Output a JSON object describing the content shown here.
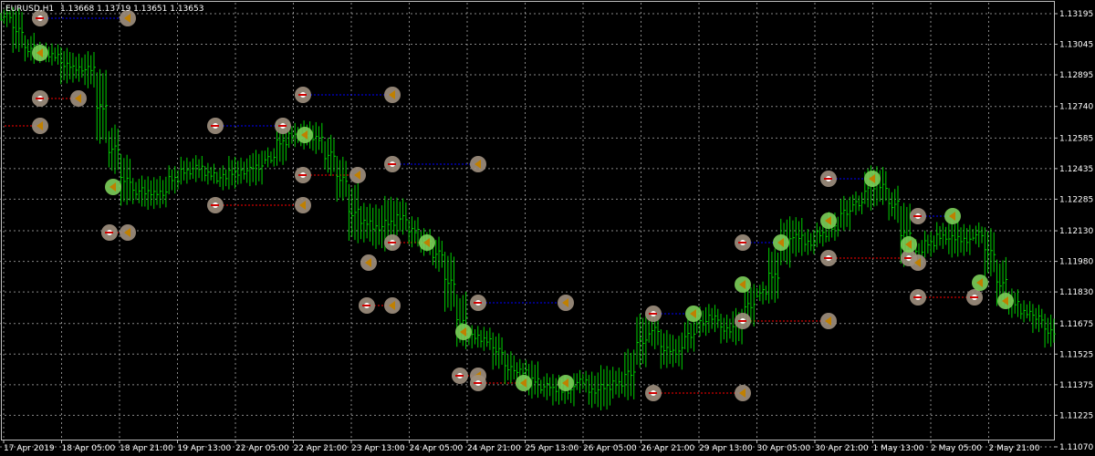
{
  "window": {
    "symbol_label": "EURUSD,H1",
    "ohlc_label": "1.13668 1.13719 1.13651 1.13653"
  },
  "colors": {
    "background": "#000000",
    "grid": "#c0c0c0",
    "bull_bar": "#00d000",
    "bear_bar": "#00d000",
    "buy_line": "#0000ff",
    "sell_line": "#ff0000",
    "marker_ring": "#a09080",
    "marker_green": "#7ccf5a",
    "marker_arrow": "#c08000",
    "axis_text": "#ffffff"
  },
  "chart_data": {
    "type": "line",
    "title": "EURUSD,H1 1.13668 1.13719 1.13651 1.13653",
    "xlabel": "",
    "ylabel": "",
    "ylim": [
      1.1107,
      1.13195
    ],
    "y_ticks": [
      "1.13195",
      "1.13045",
      "1.12895",
      "1.12740",
      "1.12585",
      "1.12435",
      "1.12285",
      "1.12130",
      "1.11980",
      "1.11830",
      "1.11675",
      "1.11525",
      "1.11375",
      "1.11225",
      "1.11070"
    ],
    "x_ticks": [
      "17 Apr 2019",
      "18 Apr 05:00",
      "18 Apr 21:00",
      "19 Apr 13:00",
      "22 Apr 05:00",
      "22 Apr 21:00",
      "23 Apr 13:00",
      "24 Apr 05:00",
      "24 Apr 21:00",
      "25 Apr 13:00",
      "26 Apr 05:00",
      "26 Apr 21:00",
      "29 Apr 13:00",
      "30 Apr 05:00",
      "30 Apr 21:00",
      "1 May 13:00",
      "2 May 05:00",
      "2 May 21:00"
    ],
    "grid": true,
    "series": [
      {
        "values": [
          1.1318,
          1.1305,
          1.13,
          1.1301,
          1.1298,
          1.129,
          1.1296,
          1.1288,
          1.126,
          1.1246,
          1.123,
          1.1235,
          1.1228,
          1.1236,
          1.124,
          1.1245,
          1.1242,
          1.124,
          1.1238,
          1.1245,
          1.124,
          1.1248,
          1.125,
          1.1262,
          1.1258,
          1.1262,
          1.1255,
          1.1245,
          1.1232,
          1.1212,
          1.1222,
          1.1208,
          1.1225,
          1.1215,
          1.121,
          1.1205,
          1.1198,
          1.1178,
          1.116,
          1.1162,
          1.1158,
          1.115,
          1.1142,
          1.1145,
          1.1135,
          1.1138,
          1.1132,
          1.1138,
          1.114,
          1.113,
          1.1142,
          1.1135,
          1.115,
          1.1168,
          1.116,
          1.115,
          1.1158,
          1.1165,
          1.1172,
          1.1168,
          1.1162,
          1.117,
          1.1183,
          1.1182,
          1.12,
          1.1215,
          1.1205,
          1.121,
          1.1212,
          1.1218,
          1.1225,
          1.1228,
          1.124,
          1.123,
          1.1222,
          1.12,
          1.1205,
          1.1208,
          1.1213,
          1.1205,
          1.1212,
          1.121,
          1.1195,
          1.118,
          1.1175,
          1.1172,
          1.1168,
          1.116
        ]
      }
    ]
  }
}
